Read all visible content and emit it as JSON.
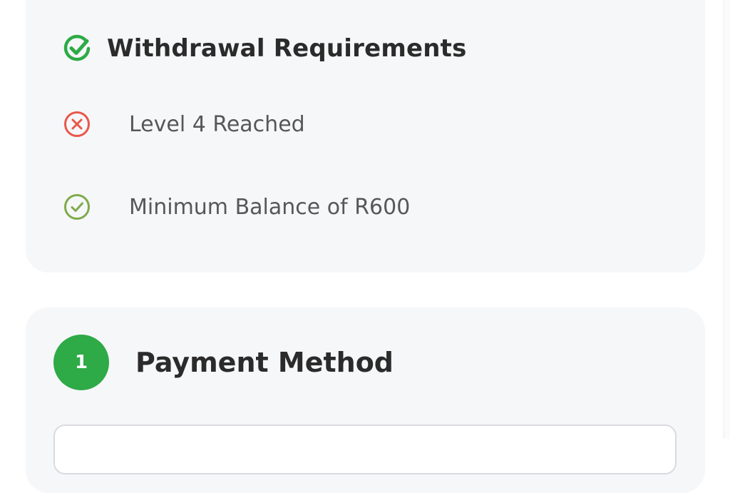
{
  "requirements": {
    "title": "Withdrawal Requirements",
    "title_icon": "check-circle-icon",
    "items": [
      {
        "label": "Level 4 Reached",
        "status": "not-met",
        "icon": "x-circle-icon",
        "color": "#e8574a"
      },
      {
        "label": "Minimum Balance of R600",
        "status": "met",
        "icon": "check-circle-icon",
        "color": "#7faa4a"
      }
    ]
  },
  "payment": {
    "step_number": "1",
    "title": "Payment Method"
  },
  "colors": {
    "accent_green": "#2eaa46",
    "card_background": "#f6f7f9",
    "error_red": "#e8574a",
    "success_olive": "#7faa4a"
  }
}
